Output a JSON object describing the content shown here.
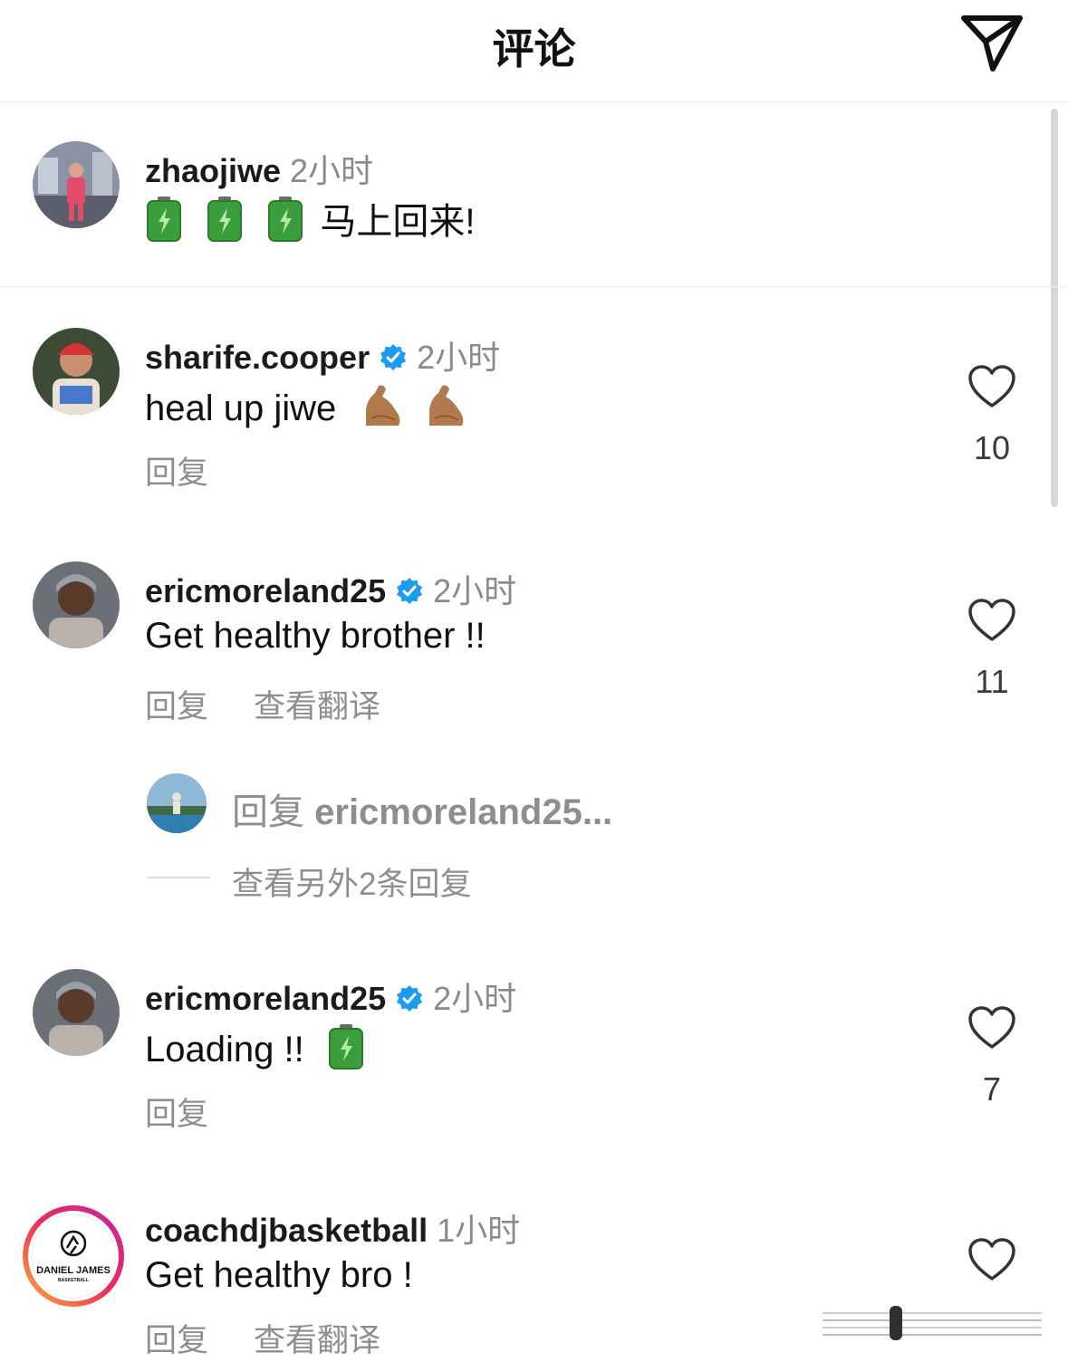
{
  "header": {
    "title": "评论",
    "send_icon": "send-paper-plane-icon"
  },
  "comments": [
    {
      "username": "zhaojiwe",
      "verified": false,
      "time": "2小时",
      "emoji": [
        "battery",
        "battery",
        "battery"
      ],
      "text": "马上回来!",
      "likes": "",
      "actions": []
    },
    {
      "username": "sharife.cooper",
      "verified": true,
      "time": "2小时",
      "text": "heal up jiwe",
      "emoji": [
        "flexed-biceps",
        "flexed-biceps"
      ],
      "likes": "10",
      "actions": [
        "回复"
      ]
    },
    {
      "username": "ericmoreland25",
      "verified": true,
      "time": "2小时",
      "text": "Get healthy brother !!",
      "likes": "11",
      "actions": [
        "回复",
        "查看翻译"
      ]
    },
    {
      "username": "ericmoreland25",
      "verified": true,
      "time": "2小时",
      "text": "Loading !!",
      "emoji": [
        "battery"
      ],
      "likes": "7",
      "actions": [
        "回复"
      ]
    },
    {
      "username": "coachdjbasketball",
      "verified": false,
      "time": "1小时",
      "text": "Get healthy bro !",
      "likes": "",
      "actions": [
        "回复",
        "查看翻译"
      ],
      "avatar_text": "DANIEL JAMES",
      "avatar_subtext": "BASKETBALL"
    }
  ],
  "reply_preview": {
    "prefix": "回复",
    "username": "ericmoreland25..."
  },
  "view_more_replies": "查看另外2条回复",
  "colors": {
    "verified": "#1d9bf0",
    "muted": "#8e8e8e",
    "battery": "#3a9e3a",
    "biceps": "#b07a4e"
  }
}
